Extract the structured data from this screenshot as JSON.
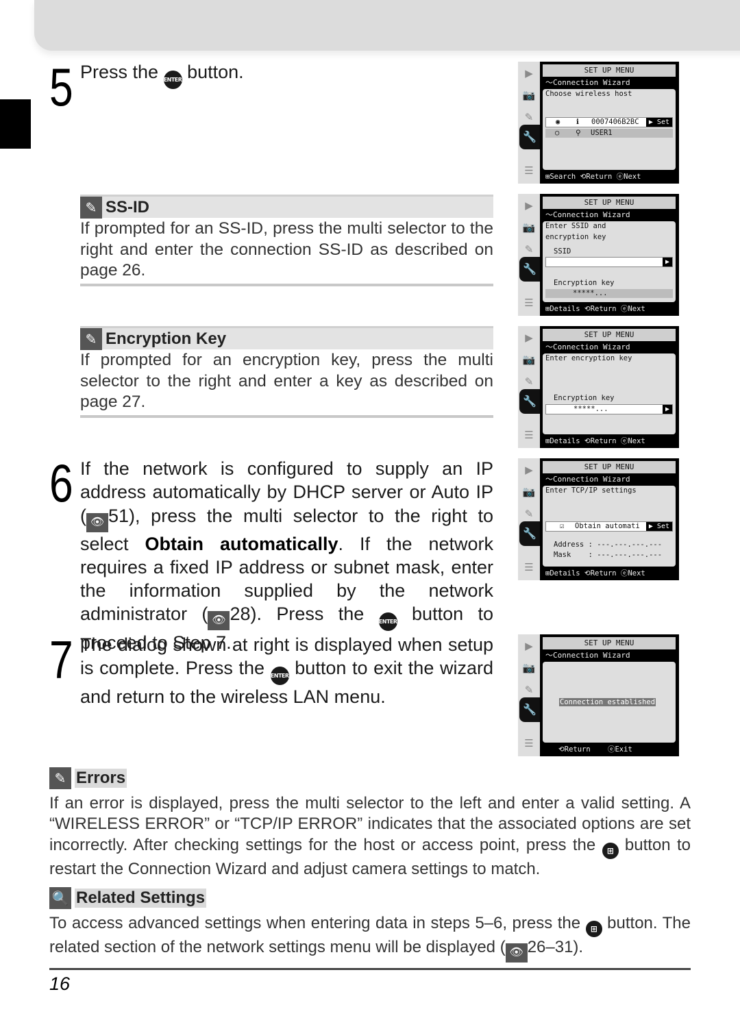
{
  "page_number": "16",
  "step5": {
    "number": "5",
    "pre": "Press the ",
    "button_icon": "ENTER",
    "post": " button."
  },
  "note_ssid": {
    "title": "SS-ID",
    "icon": "✎",
    "body": "If prompted for an SS-ID, press the multi selector to the right and enter the connection SS-ID as described on page 26."
  },
  "note_enc": {
    "title": "Encryption Key",
    "icon": "✎",
    "body": "If prompted for an encryption key, press the multi selector to the right and enter a key as described on page 27."
  },
  "step6": {
    "number": "6",
    "t1": "If the network is configured to supply an IP address automatically by DHCP server or Auto IP (",
    "ref1": "51), press the multi selector to the right to select ",
    "bold": "Obtain automatically",
    "t2": ".  If the network requires a fixed IP address or subnet mask, enter the information supplied by the network administrator (",
    "ref2": "28).  Press the ",
    "button_icon": "ENTER",
    "t3": " button to proceed to Step 7."
  },
  "step7": {
    "number": "7",
    "t1": "The dialog shown at right is displayed when setup is complete.  Press the ",
    "button_icon": "ENTER",
    "t2": " button to exit the wizard and return to the wireless LAN menu."
  },
  "errors": {
    "title": "Errors",
    "icon": "✎",
    "t1": "If an error is displayed, press the multi selector to the left and enter a valid setting.  A “WIRELESS ERROR” or “TCP/IP ERROR” indicates that the associated options are set incorrectly.  After checking settings for the host or access point, press the ",
    "button_icon": "⊞",
    "t2": " button to restart the Connection Wizard and adjust camera settings to match."
  },
  "related": {
    "title": "Related Settings",
    "icon": "🔍",
    "t1": "To access advanced settings when entering data in steps 5–6, press the ",
    "button_icon": "⊞",
    "t2": " button.  The related section of the network settings menu will be displayed (",
    "ref": "26–31)."
  },
  "ref_icon": "👁",
  "lcd_common": {
    "title": "SET UP MENU",
    "subtitle": "〜Connection Wizard",
    "rail_icons": [
      "▶",
      "📷",
      "✎",
      "🔧",
      "☰"
    ]
  },
  "lcd1": {
    "prompt": "Choose wireless host",
    "rows": [
      {
        "radio": "◉",
        "icon": "ℹ",
        "label": "0007406B2BC",
        "action": "▶ Set",
        "selected": true
      },
      {
        "radio": "○",
        "icon": "⚲",
        "label": "USER1",
        "selected": false
      }
    ],
    "footer": "⊞Search ⟲Return ⓔNext"
  },
  "lcd2": {
    "prompt_l1": "Enter SSID and",
    "prompt_l2": "encryption key",
    "ssid_label": "SSID",
    "ssid_value": "",
    "enc_label": "Encryption key",
    "enc_value": "*****...",
    "arrow": "▶",
    "footer": "⊞Details ⟲Return ⓔNext"
  },
  "lcd3": {
    "prompt": "Enter encryption key",
    "enc_label": "Encryption key",
    "enc_value": "*****...",
    "arrow": "▶",
    "footer": "⊞Details ⟲Return ⓔNext"
  },
  "lcd4": {
    "prompt": "Enter TCP/IP settings",
    "checkbox": "☑",
    "option": "Obtain automati",
    "action": "▶ Set",
    "address_row": "Address : ---.---.---.---",
    "mask_row": "Mask    : ---.---.---.---",
    "footer": "⊞Details ⟲Return ⓔNext"
  },
  "lcd5": {
    "message": "Connection established",
    "footer": "   ⟲Return    ⓔExit"
  }
}
